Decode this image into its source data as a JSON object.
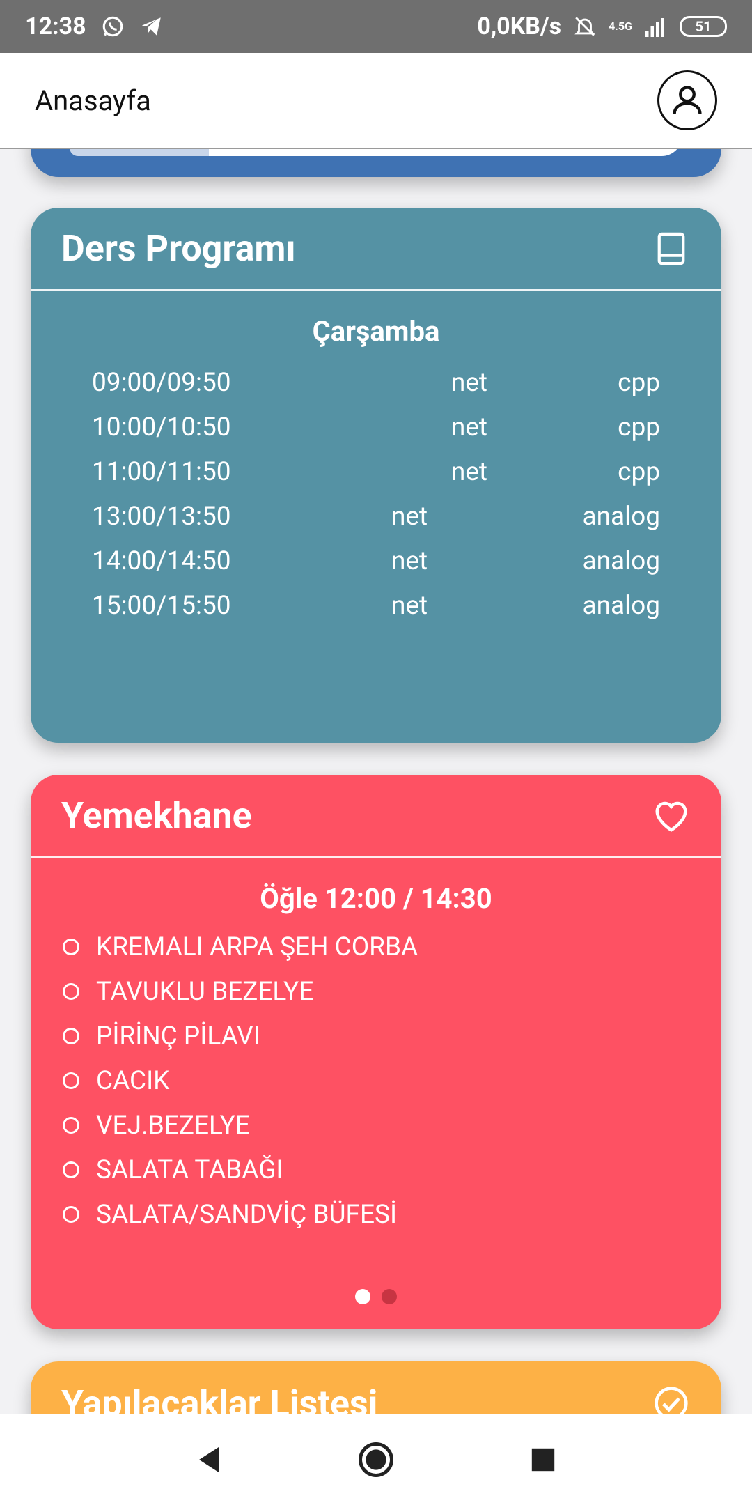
{
  "status_bar": {
    "time": "12:38",
    "network_speed": "0,0KB/s",
    "network_type": "4.5G",
    "battery": "51"
  },
  "app_bar": {
    "title": "Anasayfa"
  },
  "schedule_card": {
    "title": "Ders Programı",
    "day": "Çarşamba",
    "rows": [
      {
        "time": "09:00/09:50",
        "room": "net",
        "course": "cpp"
      },
      {
        "time": "10:00/10:50",
        "room": "net",
        "course": "cpp"
      },
      {
        "time": "11:00/11:50",
        "room": "net",
        "course": "cpp"
      },
      {
        "time": "13:00/13:50",
        "room": "net",
        "course": "analog"
      },
      {
        "time": "14:00/14:50",
        "room": "net",
        "course": "analog"
      },
      {
        "time": "15:00/15:50",
        "room": "net",
        "course": "analog"
      }
    ],
    "color": "#5592a4"
  },
  "cafeteria_card": {
    "title": "Yemekhane",
    "meal": "Öğle 12:00 / 14:30",
    "items": [
      "KREMALI ARPA ŞEH CORBA",
      "TAVUKLU BEZELYE",
      "PİRİNÇ PİLAVI",
      "CACIK",
      "VEJ.BEZELYE",
      "SALATA TABAĞI",
      "SALATA/SANDVİÇ BÜFESİ"
    ],
    "page_indicator": {
      "pages": 2,
      "active": 1
    },
    "color": "#fe5163"
  },
  "todo_card": {
    "title": "Yapılacaklar Listesi",
    "color": "#fdb146"
  },
  "top_card": {
    "color": "#3f72b3"
  }
}
